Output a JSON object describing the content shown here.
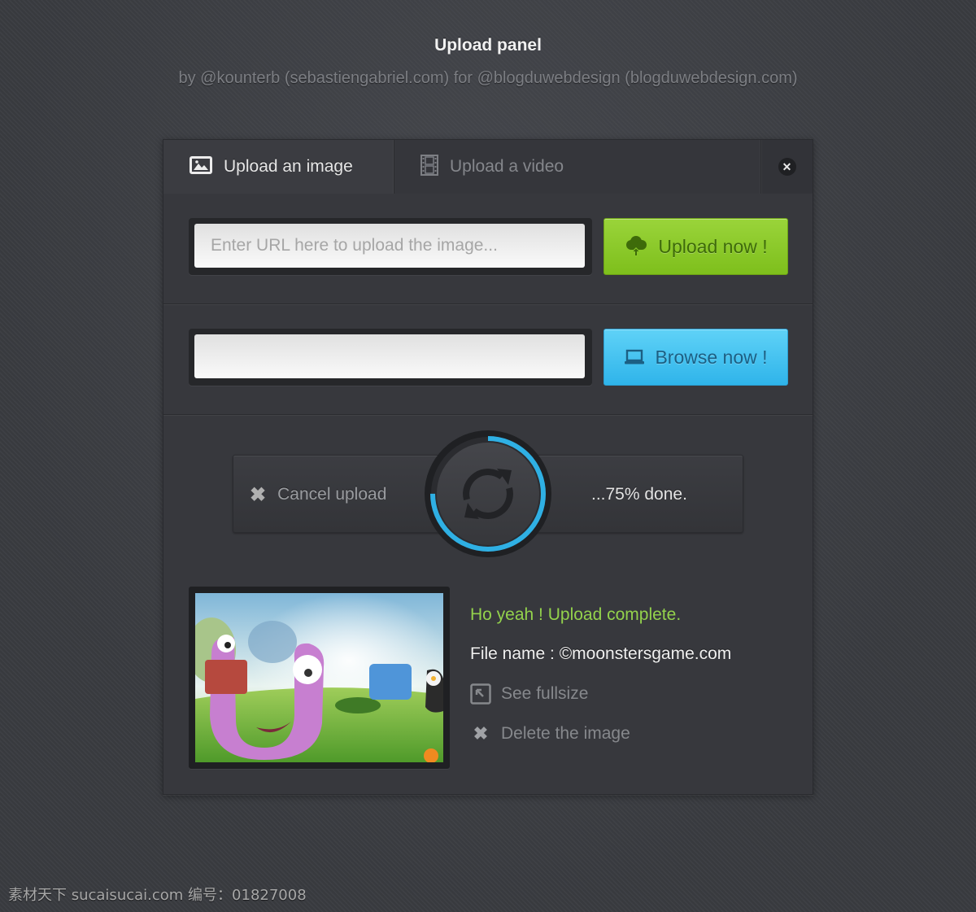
{
  "header": {
    "title": "Upload panel",
    "subtitle": "by @kounterb (sebastiengabriel.com) for @blogduwebdesign (blogduwebdesign.com)"
  },
  "tabs": [
    {
      "label": "Upload an image",
      "icon": "image-icon",
      "active": true
    },
    {
      "label": "Upload a video",
      "icon": "film-icon",
      "active": false
    }
  ],
  "close": {
    "icon": "close-icon",
    "glyph": "✕"
  },
  "url_upload": {
    "placeholder": "Enter URL here to upload the image...",
    "value": "",
    "button_label": "Upload now !",
    "button_icon": "cloud-upload-icon",
    "button_color": "#8ccb2a"
  },
  "browse": {
    "value": "",
    "button_label": "Browse now !",
    "button_icon": "laptop-icon",
    "button_color": "#45c2f0"
  },
  "progress": {
    "cancel_label": "Cancel upload",
    "cancel_glyph": "✖",
    "percent": 75,
    "done_label": "...75% done.",
    "ring_color": "#2fb0e4",
    "center_icon": "refresh-icon"
  },
  "result": {
    "thumbnail_alt": "Moonsters game illustration",
    "status": "Ho yeah ! Upload complete.",
    "status_color": "#93d24c",
    "file_name": "File name : ©moonstersgame.com",
    "see_fullsize_label": "See fullsize",
    "delete_label": "Delete the image",
    "delete_glyph": "✖"
  },
  "watermark": "素材天下 sucaisucai.com   编号：01827008"
}
